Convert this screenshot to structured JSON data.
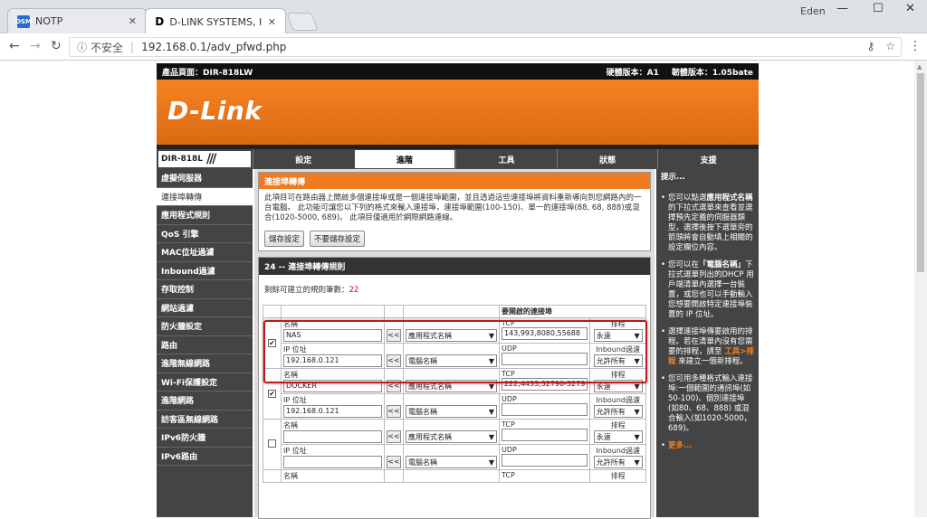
{
  "browser": {
    "tabs": [
      {
        "title": "NOTP",
        "favicon": "DSM"
      },
      {
        "title": "D-LINK SYSTEMS, INC. |",
        "favicon": "D"
      }
    ],
    "user": "Eden",
    "security": "不安全",
    "url": "192.168.0.1/adv_pfwd.php"
  },
  "header": {
    "product": "產品頁面：DIR-818LW",
    "hw": "硬體版本：A1",
    "fw": "韌體版本：1.05bate",
    "logo": "D-Link",
    "model": "DIR-818L"
  },
  "nav_tabs": [
    "設定",
    "進階",
    "工具",
    "狀態",
    "支援"
  ],
  "active_tab_index": 1,
  "sidebar": [
    "虛擬伺服器",
    "連接埠轉傳",
    "應用程式規則",
    "QoS 引擎",
    "MAC位址過濾",
    "Inbound過濾",
    "存取控制",
    "網站過濾",
    "防火牆設定",
    "路由",
    "進階無線網路",
    "Wi-Fi保護設定",
    "進階網路",
    "訪客區無線網路",
    "IPv6防火牆",
    "IPv6路由"
  ],
  "active_sidebar_index": 1,
  "intro": {
    "title": "連接埠轉傳",
    "text": "此項目可在路由器上開啟多個連接埠或是一個連接埠範圍，並且透過這些連接埠將資料重新導向到您網路內的一台電腦。 此功能可讓您以下列的格式來輸入連接埠，連接埠範圍(100-150)、單一的連接埠(88, 68, 888)或混合(1020-5000, 689)。 此項目僅適用於網際網路連線。",
    "save": "儲存設定",
    "nosave": "不要儲存設定"
  },
  "rules_section": {
    "title": "24 -- 連接埠轉傳規則",
    "remain_label": "剩餘可建立的規則筆數：",
    "remain_count": "22",
    "ports_header": "要開啟的連接埠",
    "name_label": "名稱",
    "ip_label": "IP 位址",
    "tcp_label": "TCP",
    "udp_label": "UDP",
    "schedule_label": "排程",
    "inbound_label": "Inbound過濾",
    "app_select": "應用程式名稱",
    "pc_select": "電腦名稱",
    "arrow": "<<"
  },
  "rules": [
    {
      "checked": true,
      "name": "NAS",
      "ip": "192.168.0.121",
      "tcp": "143,993,8080,55688",
      "udp": "",
      "schedule": "永遠",
      "inbound": "允許所有"
    },
    {
      "checked": true,
      "name": "DOCKER",
      "ip": "192.168.0.121",
      "tcp": "222,4433,32790-3279",
      "udp": "",
      "schedule": "永遠",
      "inbound": "允許所有"
    },
    {
      "checked": false,
      "name": "",
      "ip": "",
      "tcp": "",
      "udp": "",
      "schedule": "永遠",
      "inbound": "允許所有"
    }
  ],
  "next_row_labels": {
    "name": "名稱",
    "tcp": "TCP",
    "schedule": "排程"
  },
  "hints": {
    "title": "提示...",
    "h1a": "您可以點選",
    "h1b": "應用程式名稱",
    "h1c": "的下拉式選單來查看並選擇預先定義的伺服器類型，選擇後按下選單旁的箭頭將會自動填上相關的設定欄位內容。",
    "h2a": "您可以在",
    "h2b": "「電腦名稱」",
    "h2c": "下拉式選單列出的DHCP 用戶端清單內選擇一台裝置，或您也可以手動輸入您想要開啟特定連接埠裝置的 IP 位址。",
    "h3a": "選擇連接埠傳要啟用的排程。若在清單內沒有您需要的排程，請至",
    "h3b": "工具>排程",
    "h3c": "來建立一個新排程。",
    "h4": "您可用多種格式輸入連接埠:一個範圍的通訊埠(如50-100)、個別連接埠(如80、68、888) 或混合輸入(如1020-5000，689)。",
    "more": "更多..."
  }
}
